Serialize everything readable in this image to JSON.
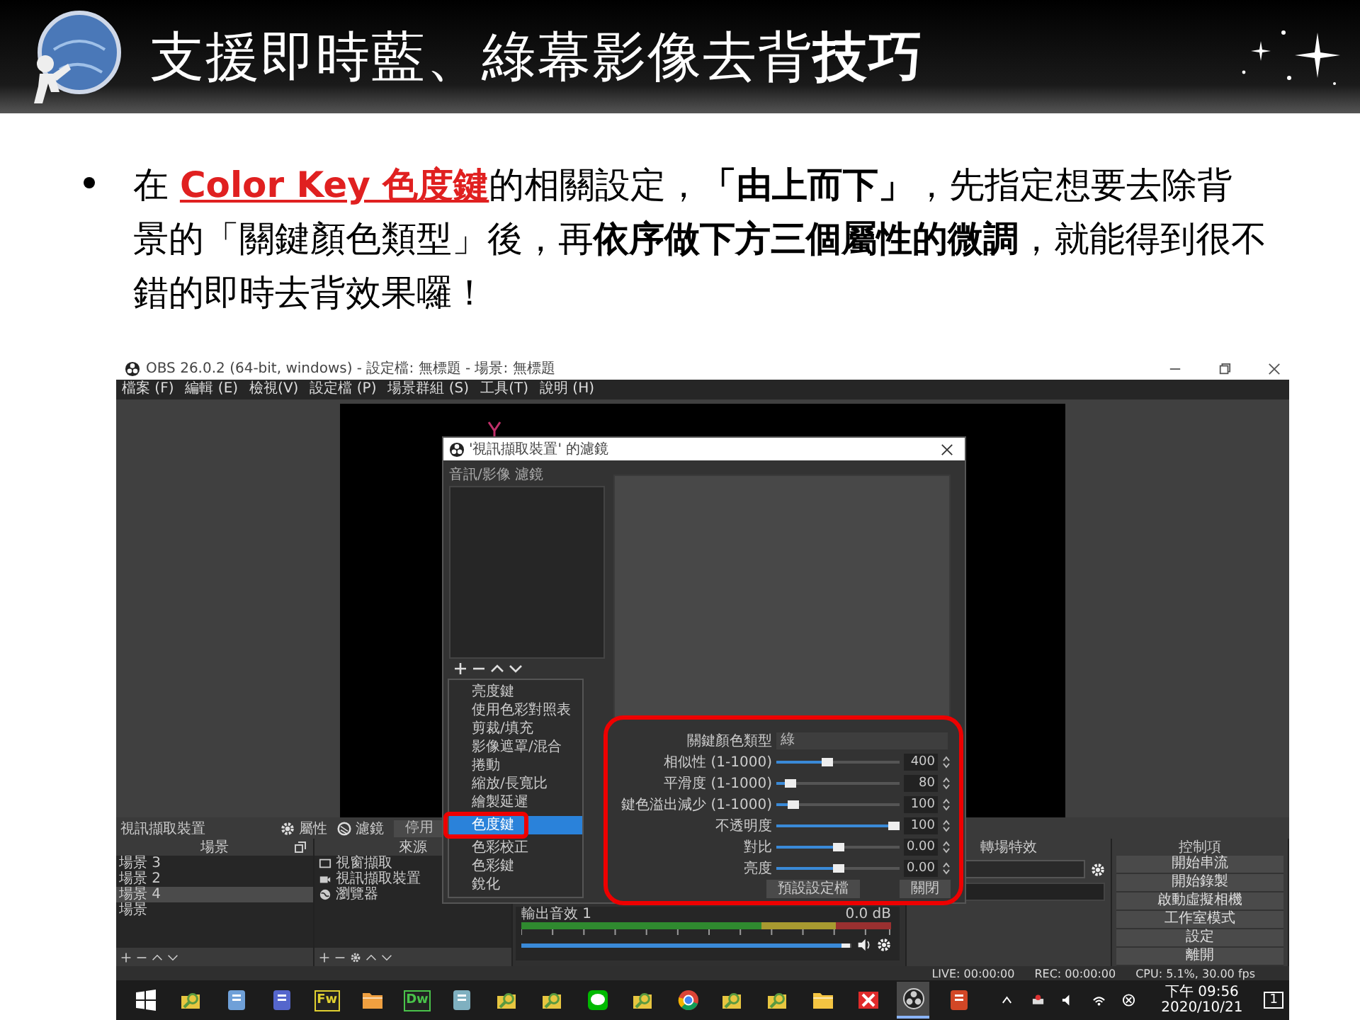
{
  "slide": {
    "title": "支援即時藍、綠幕影像去背**技巧**"
  },
  "bullet": {
    "runs": [
      {
        "text": "在 ",
        "kind": "plain"
      },
      {
        "text": "Color Key 色度鍵",
        "kind": "key"
      },
      {
        "text": "的相關設定，",
        "kind": "plain"
      },
      {
        "text": "「由上而下」",
        "kind": "bold"
      },
      {
        "text": "，先指定想要去除背景的「關鍵顏色類型」後，再",
        "kind": "plain"
      },
      {
        "text": "依序做下方三個屬性的微調",
        "kind": "bold"
      },
      {
        "text": "，就能得到很不錯的即時去背效果囉！",
        "kind": "plain"
      }
    ]
  },
  "obs": {
    "title": "OBS 26.0.2 (64-bit, windows) - 設定檔: 無標題 - 場景: 無標題",
    "menu": [
      "檔案 (F)",
      "編輯 (E)",
      "檢視(V)",
      "設定檔 (P)",
      "場景群組 (S)",
      "工具(T)",
      "說明 (H)"
    ],
    "source_bar": {
      "name": "視訊擷取裝置",
      "properties": "屬性",
      "filters": "濾鏡",
      "disable": "停用"
    },
    "scenes": {
      "title": "場景",
      "items": [
        {
          "label": "場景 3",
          "selected": false
        },
        {
          "label": "場景 2",
          "selected": false
        },
        {
          "label": "場景 4",
          "selected": true
        },
        {
          "label": "場景",
          "selected": false
        }
      ],
      "tools": [
        {
          "kind": "add"
        },
        {
          "kind": "remove"
        },
        {
          "kind": "up"
        },
        {
          "kind": "down"
        }
      ]
    },
    "sources": {
      "title": "來源",
      "items": [
        {
          "label": "視窗擷取",
          "kind": "window"
        },
        {
          "label": "視訊擷取裝置",
          "kind": "camera"
        },
        {
          "label": "瀏覽器",
          "kind": "globe"
        }
      ],
      "tools": [
        {
          "kind": "add"
        },
        {
          "kind": "remove"
        },
        {
          "kind": "gear"
        },
        {
          "kind": "up"
        },
        {
          "kind": "down"
        }
      ]
    },
    "mixer": {
      "channel": "輸出音效 1",
      "reading": "0.0 dB",
      "level": 0.97
    },
    "transitions": {
      "title": "轉場特效"
    },
    "controls": {
      "title": "控制項",
      "buttons": [
        "開始串流",
        "開始錄製",
        "啟動虛擬相機",
        "工作室模式",
        "設定",
        "離開"
      ]
    },
    "status": {
      "live": "LIVE: 00:00:00",
      "rec": "REC: 00:00:00",
      "cpu": "CPU: 5.1%, 30.00 fps"
    },
    "dialog": {
      "title": "'視訊擷取裝置' 的濾鏡",
      "list_label": "音訊/影像 濾鏡",
      "tools": [
        {
          "kind": "add"
        },
        {
          "kind": "remove"
        },
        {
          "kind": "up"
        },
        {
          "kind": "down"
        }
      ],
      "menu": [
        {
          "label": "亮度鍵",
          "selected": false
        },
        {
          "label": "使用色彩對照表",
          "selected": false
        },
        {
          "label": "剪裁/填充",
          "selected": false
        },
        {
          "label": "影像遮罩/混合",
          "selected": false
        },
        {
          "label": "捲動",
          "selected": false
        },
        {
          "label": "縮放/長寬比",
          "selected": false
        },
        {
          "label": "繪製延遲",
          "selected": false
        },
        {
          "label": "色度鍵",
          "selected": true
        },
        {
          "label": "色彩校正",
          "selected": false
        },
        {
          "label": "色彩鍵",
          "selected": false
        },
        {
          "label": "銳化",
          "selected": false
        }
      ],
      "key_type": {
        "label": "關鍵顏色類型",
        "value": "綠"
      },
      "sliders": [
        {
          "label": "相似性 (1-1000)",
          "level": 0.4,
          "value": "400"
        },
        {
          "label": "平滑度 (1-1000)",
          "level": 0.08,
          "value": "80"
        },
        {
          "label": "鍵色溢出減少 (1-1000)",
          "level": 0.1,
          "value": "100"
        },
        {
          "label": "不透明度",
          "level": 1,
          "value": "100"
        },
        {
          "label": "對比",
          "level": 0.5,
          "value": "0.00"
        },
        {
          "label": "亮度",
          "level": 0.5,
          "value": "0.00"
        }
      ],
      "buttons": [
        "預設設定檔",
        "關閉"
      ]
    }
  },
  "taskbar": {
    "apps": [
      {
        "kind": "start",
        "active": false
      },
      {
        "kind": "person",
        "active": false
      },
      {
        "kind": "tile",
        "color": "#6fa0d8",
        "active": false
      },
      {
        "kind": "tile",
        "color": "#5566cc",
        "active": false
      },
      {
        "kind": "lettered",
        "label": "Fw",
        "color": "#e0d030",
        "active": false
      },
      {
        "kind": "folder",
        "color": "#f0a040",
        "active": false
      },
      {
        "kind": "lettered",
        "label": "Dw",
        "color": "#49c34a",
        "active": false
      },
      {
        "kind": "tile",
        "color": "#7fb0c0",
        "active": false
      },
      {
        "kind": "person",
        "active": false
      },
      {
        "kind": "person",
        "active": false
      },
      {
        "kind": "chat",
        "color": "#00b900",
        "active": false
      },
      {
        "kind": "person",
        "active": false
      },
      {
        "kind": "orb",
        "active": false
      },
      {
        "kind": "person",
        "active": false
      },
      {
        "kind": "person",
        "active": false
      },
      {
        "kind": "folder",
        "color": "#f5c542",
        "active": false
      },
      {
        "kind": "cross",
        "color": "#e02a2a",
        "active": false
      },
      {
        "kind": "rings",
        "active": true
      },
      {
        "kind": "tile",
        "color": "#d24726",
        "active": false
      }
    ],
    "time": "下午 09:56",
    "date": "2020/10/21",
    "notifications": "1"
  }
}
